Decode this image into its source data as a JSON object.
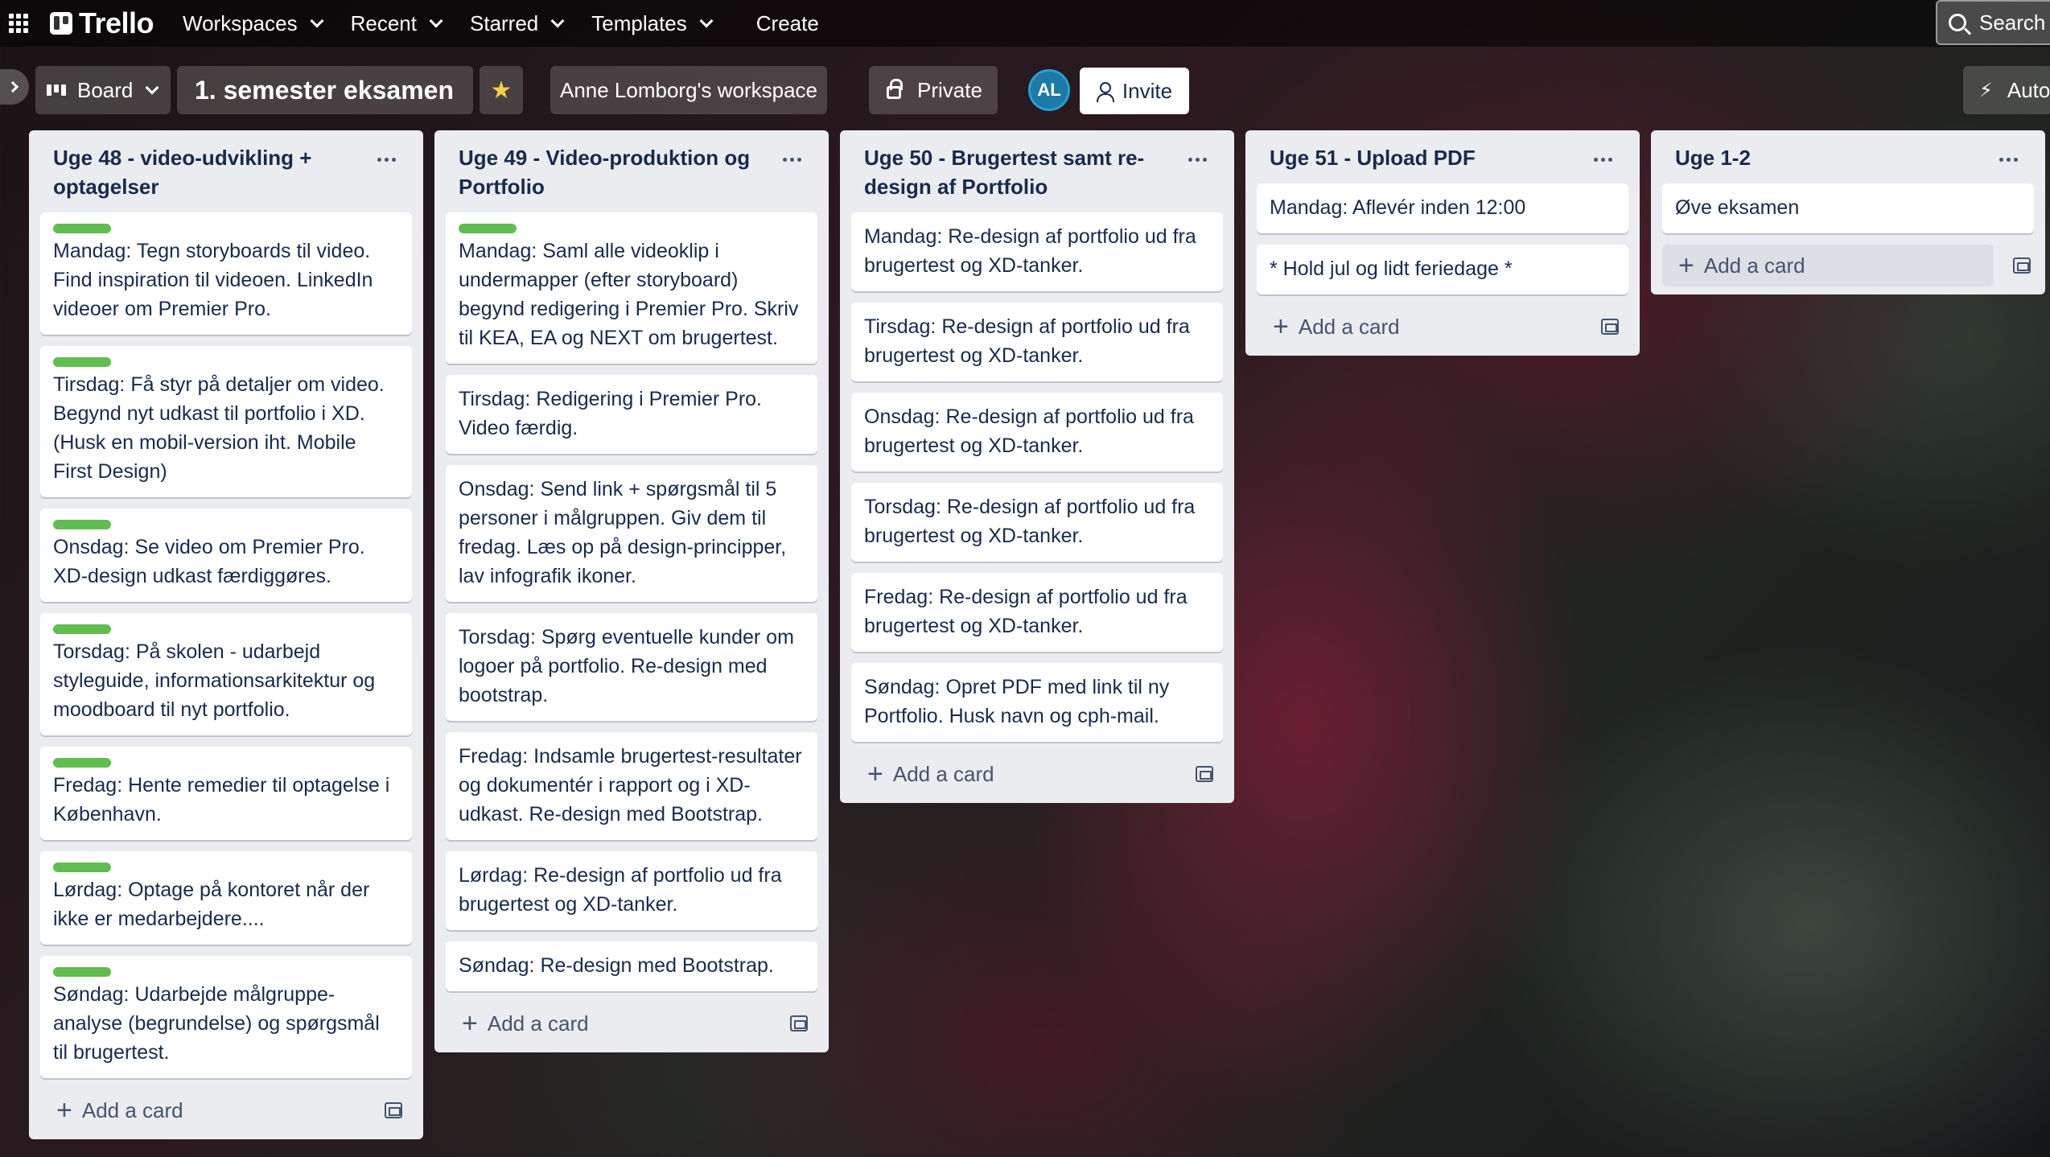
{
  "topnav": {
    "logo_text": "Trello",
    "menus": [
      "Workspaces",
      "Recent",
      "Starred",
      "Templates"
    ],
    "create_label": "Create",
    "search_label": "Search"
  },
  "board_header": {
    "view_label": "Board",
    "title": "1. semester eksamen",
    "workspace_label": "Anne Lomborg's workspace",
    "visibility_label": "Private",
    "avatar_initials": "AL",
    "invite_label": "Invite",
    "automation_label": "Auto"
  },
  "lists": [
    {
      "title": "Uge 48 - video-udvikling + optagelser",
      "cards": [
        {
          "text": "Mandag: Tegn storyboards til video. Find inspiration til videoen. LinkedIn videoer om Premier Pro.",
          "label": true
        },
        {
          "text": "Tirsdag: Få styr på detaljer om video. Begynd nyt udkast til portfolio i XD. (Husk en mobil-version iht. Mobile First Design)",
          "label": true
        },
        {
          "text": "Onsdag: Se video om Premier Pro. XD-design udkast færdiggøres.",
          "label": true
        },
        {
          "text": "Torsdag: På skolen - udarbejd styleguide, informationsarkitektur og moodboard til nyt portfolio.",
          "label": true
        },
        {
          "text": "Fredag: Hente remedier til optagelse i København.",
          "label": true
        },
        {
          "text": "Lørdag: Optage på kontoret når der ikke er medarbejdere....",
          "label": true
        },
        {
          "text": "Søndag: Udarbejde målgruppe-analyse (begrundelse) og spørgsmål til brugertest.",
          "label": true
        }
      ],
      "add_label": "Add a card"
    },
    {
      "title": "Uge 49 - Video-produktion og Portfolio",
      "cards": [
        {
          "text": "Mandag: Saml alle videoklip i undermapper (efter storyboard) begynd redigering i Premier Pro. Skriv til KEA, EA og NEXT om brugertest.",
          "label": true
        },
        {
          "text": "Tirsdag: Redigering i Premier Pro. Video færdig.",
          "label": false
        },
        {
          "text": "Onsdag: Send link + spørgsmål til 5 personer i målgruppen. Giv dem til fredag. Læs op på design-principper, lav infografik ikoner.",
          "label": false
        },
        {
          "text": "Torsdag: Spørg eventuelle kunder om logoer på portfolio. Re-design med bootstrap.",
          "label": false
        },
        {
          "text": "Fredag: Indsamle brugertest-resultater og dokumentér i rapport og i XD-udkast. Re-design med Bootstrap.",
          "label": false
        },
        {
          "text": "Lørdag: Re-design af portfolio ud fra brugertest og XD-tanker.",
          "label": false
        },
        {
          "text": "Søndag: Re-design med Bootstrap.",
          "label": false
        }
      ],
      "add_label": "Add a card"
    },
    {
      "title": "Uge 50 - Brugertest samt re-design af Portfolio",
      "cards": [
        {
          "text": "Mandag: Re-design af portfolio ud fra brugertest og XD-tanker.",
          "label": false
        },
        {
          "text": "Tirsdag: Re-design af portfolio ud fra brugertest og XD-tanker.",
          "label": false
        },
        {
          "text": "Onsdag: Re-design af portfolio ud fra brugertest og XD-tanker.",
          "label": false
        },
        {
          "text": "Torsdag: Re-design af portfolio ud fra brugertest og XD-tanker.",
          "label": false
        },
        {
          "text": "Fredag: Re-design af portfolio ud fra brugertest og XD-tanker.",
          "label": false
        },
        {
          "text": "Søndag: Opret PDF med link til ny Portfolio. Husk navn og cph-mail.",
          "label": false
        }
      ],
      "add_label": "Add a card"
    },
    {
      "title": "Uge 51 - Upload PDF",
      "cards": [
        {
          "text": "Mandag: Aflevér inden 12:00",
          "label": false
        },
        {
          "text": "* Hold jul og lidt feriedage *",
          "label": false
        }
      ],
      "add_label": "Add a card"
    },
    {
      "title": "Uge 1-2",
      "cards": [
        {
          "text": "Øve eksamen",
          "label": false
        }
      ],
      "add_label": "Add a card"
    }
  ],
  "colors": {
    "label_green": "#61bd4f",
    "list_bg": "#ebecf0",
    "star": "#f5cd47"
  }
}
